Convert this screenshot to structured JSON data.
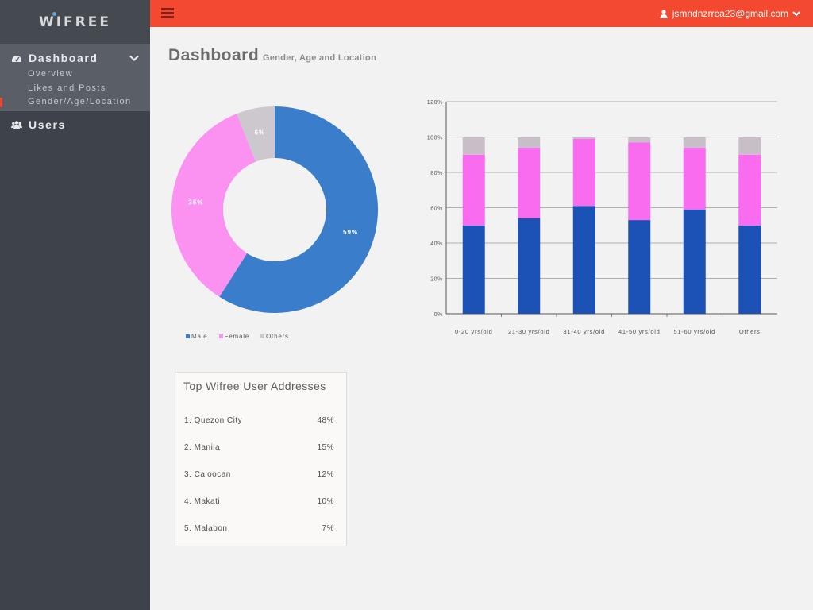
{
  "brand": {
    "name": "WIFREE"
  },
  "colors": {
    "accent": "#f24930",
    "sidebar": "#3e424a",
    "male": "#3a7dca",
    "female": "#fb91f0",
    "others": "#cdc8cd"
  },
  "sidebar": {
    "dashboard": {
      "label": "Dashboard",
      "icon": "dashboard-icon"
    },
    "subitems": [
      {
        "label": "Overview",
        "active": false
      },
      {
        "label": "Likes and Posts",
        "active": false
      },
      {
        "label": "Gender/Age/Location",
        "active": true
      }
    ],
    "users": {
      "label": "Users",
      "icon": "users-icon"
    }
  },
  "topbar": {
    "menu_icon": "hamburger-icon",
    "user_email": "jsmndnzrrea23@gmail.com"
  },
  "header": {
    "title": "Dashboard",
    "subtitle": "Gender, Age and Location"
  },
  "chart_data": [
    {
      "type": "pie",
      "variant": "donut",
      "labels": [
        "Male",
        "Female",
        "Others"
      ],
      "values": [
        59,
        35,
        6
      ],
      "data_labels": [
        "59%",
        "35%",
        "6%"
      ],
      "colors": [
        "#3a7dca",
        "#fb91f0",
        "#cdc8cd"
      ],
      "legend": "bottom-left"
    },
    {
      "type": "bar",
      "stacked": true,
      "categories": [
        "0-20 yrs/old",
        "21-30 yrs/old",
        "31-40 yrs/old",
        "41-50 yrs/old",
        "51-60 yrs/old",
        "Others"
      ],
      "series": [
        {
          "values": [
            50,
            54,
            61,
            53,
            59,
            50
          ],
          "color": "#1c52b6"
        },
        {
          "values": [
            40,
            40,
            38,
            44,
            35,
            40
          ],
          "color": "#f96cef"
        },
        {
          "values": [
            10,
            6,
            1,
            3,
            6,
            10
          ],
          "color": "#c8bec8"
        }
      ],
      "ylim": [
        0,
        120
      ],
      "yticks": [
        "0%",
        "20%",
        "40%",
        "60%",
        "80%",
        "100%",
        "120%"
      ],
      "grid": true
    }
  ],
  "addresses": {
    "title": "Top Wifree User Addresses",
    "rows": [
      {
        "name": "1. Quezon City",
        "value": "48%"
      },
      {
        "name": "2. Manila",
        "value": "15%"
      },
      {
        "name": "3. Caloocan",
        "value": "12%"
      },
      {
        "name": "4. Makati",
        "value": "10%"
      },
      {
        "name": "5. Malabon",
        "value": "7%"
      }
    ]
  }
}
